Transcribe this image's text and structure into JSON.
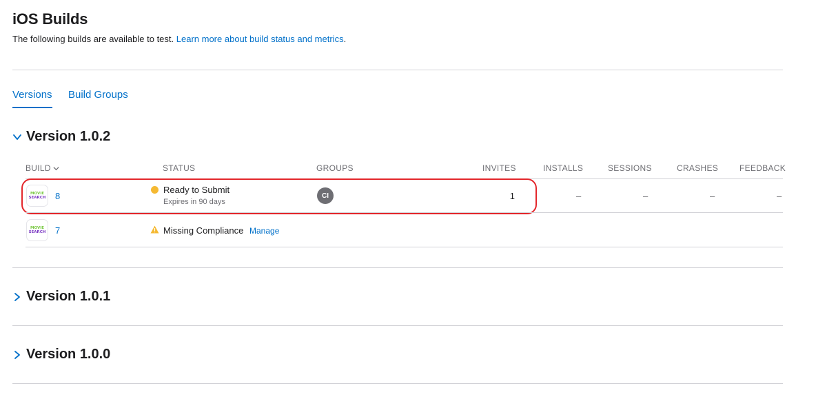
{
  "header": {
    "title": "iOS Builds",
    "subtitle": "The following builds are available to test.",
    "learn_more_link": "Learn more about build status and metrics",
    "subtitle_end": "."
  },
  "tabs": [
    {
      "label": "Versions",
      "active": true
    },
    {
      "label": "Build Groups",
      "active": false
    }
  ],
  "versions": [
    {
      "title": "Version 1.0.2",
      "expanded": true
    },
    {
      "title": "Version 1.0.1",
      "expanded": false
    },
    {
      "title": "Version 1.0.0",
      "expanded": false
    }
  ],
  "table": {
    "columns": [
      "BUILD",
      "STATUS",
      "GROUPS",
      "INVITES",
      "INSTALLS",
      "SESSIONS",
      "CRASHES",
      "FEEDBACK"
    ],
    "rows": [
      {
        "icon_text": [
          "MOVIE",
          "SEARCH"
        ],
        "build": "8",
        "status": "Ready to Submit",
        "status_sub": "Expires in 90 days",
        "status_icon": "yellow-dot",
        "group": "CI",
        "invites": "1",
        "installs": "–",
        "sessions": "–",
        "crashes": "–",
        "feedback": "–"
      },
      {
        "icon_text": [
          "MOVIE",
          "SEARCH"
        ],
        "build": "7",
        "status": "Missing Compliance",
        "status_icon": "warning-triangle",
        "manage": "Manage"
      }
    ]
  },
  "colors": {
    "link": "#0070c9",
    "divider": "#d2d2d7",
    "highlight": "#e3262b",
    "status_ready": "#f5b932",
    "warning": "#f5b932"
  }
}
